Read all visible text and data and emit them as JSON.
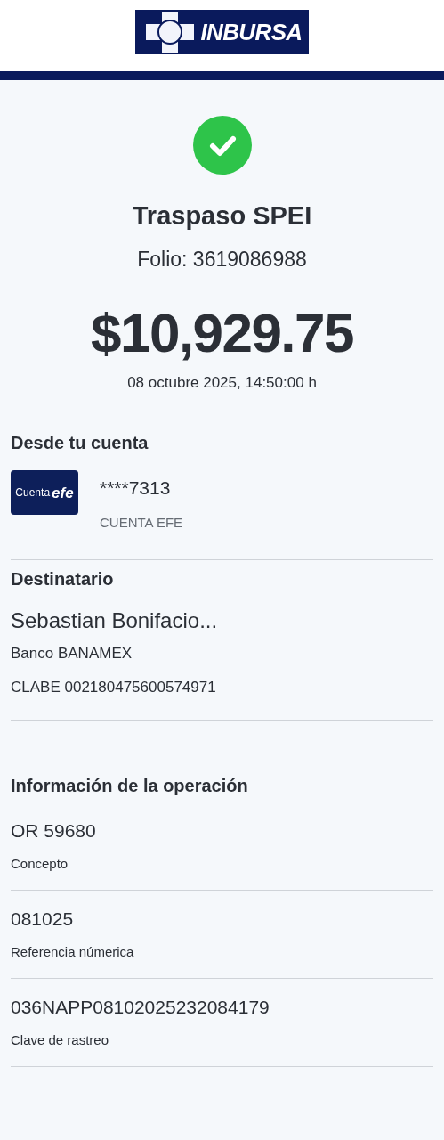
{
  "header": {
    "brand": "INBURSA"
  },
  "receipt": {
    "success": true,
    "title": "Traspaso SPEI",
    "folio": "Folio: 3619086988",
    "amount": "$10,929.75",
    "datetime": "08 octubre 2025, 14:50:00 h"
  },
  "origin": {
    "heading": "Desde tu cuenta",
    "card": {
      "prefix": "Cuenta",
      "name": "efe"
    },
    "account": "****7313",
    "account_type": "CUENTA EFE"
  },
  "recipient": {
    "heading": "Destinatario",
    "name": "Sebastian Bonifacio...",
    "bank": "Banco BANAMEX",
    "clabe": "CLABE 002180475600574971"
  },
  "operation": {
    "heading": "Información de la operación",
    "fields": [
      {
        "value": "OR 59680",
        "label": "Concepto"
      },
      {
        "value": "081025",
        "label": "Referencia númerica"
      },
      {
        "value": "036NAPP08102025232084179",
        "label": "Clave de rastreo"
      }
    ]
  }
}
